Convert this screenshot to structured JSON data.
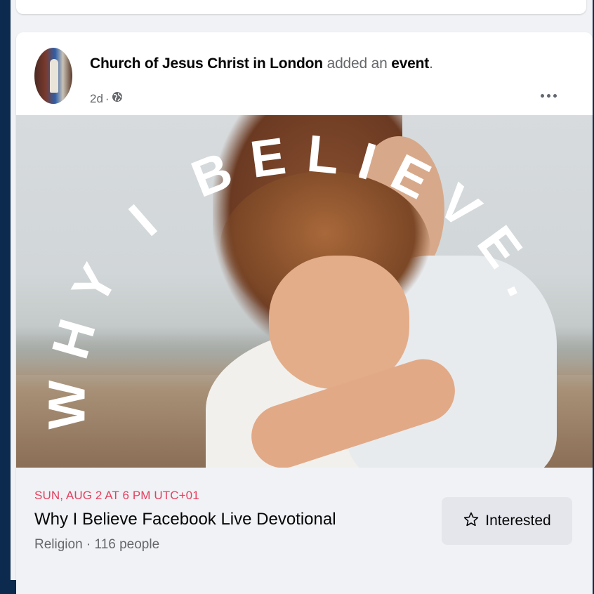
{
  "post": {
    "page_name": "Church of Jesus Christ in London",
    "action_text_1": " added an ",
    "action_object": "event",
    "action_text_2": ".",
    "time_ago": "2d",
    "separator": "·",
    "privacy_icon": "globe-icon",
    "more_icon": "more-horizontal-icon"
  },
  "image": {
    "overlay_text": "WHY I BELIEVE.",
    "overlay_color": "#ffffff"
  },
  "event": {
    "date_time": "SUN, AUG 2 AT 6 PM UTC+01",
    "title": "Why I Believe Facebook Live Devotional",
    "details": "Religion · 116 people",
    "interested_label": "Interested",
    "interested_icon": "star-outline-icon",
    "date_color": "#e4405f"
  },
  "colors": {
    "frame": "#0c2a4d",
    "feed_background": "#f0f2f5",
    "secondary_text": "#65676b",
    "button_background": "#e4e6eb"
  }
}
